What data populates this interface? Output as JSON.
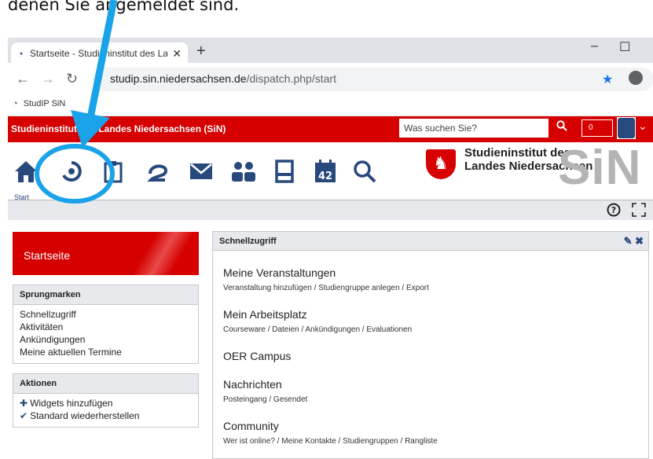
{
  "caption": "denen Sie angemeldet sind.",
  "browser": {
    "tab_title": "Startseite - Studieninstitut des La",
    "tab_close": "✕",
    "new_tab": "+",
    "minimize": "–",
    "maximize": "☐",
    "url_host": "studip.sin.niedersachsen.de",
    "url_path": "/dispatch.php/start",
    "bookmark": "StudIP SiN"
  },
  "header": {
    "site_name": "Studieninstitut des Landes Niedersachsen (SiN)",
    "search_placeholder": "Was suchen Sie?",
    "counter": "0"
  },
  "nav": {
    "start_label": "Start",
    "calendar_day": "42"
  },
  "logo": {
    "text": "Studieninstitut des\nLandes Niedersachsen",
    "sin": "SiN"
  },
  "sidebar": {
    "title": "Startseite",
    "jump_title": "Sprungmarken",
    "jump_items": [
      "Schnellzugriff",
      "Aktivitäten",
      "Ankündigungen",
      "Meine aktuellen Termine"
    ],
    "actions_title": "Aktionen",
    "action_add": "Widgets hinzufügen",
    "action_reset": "Standard wiederherstellen"
  },
  "panel": {
    "title": "Schnellzugriff",
    "sections": [
      {
        "title": "Meine Veranstaltungen",
        "links": "Veranstaltung hinzufügen / Studiengruppe anlegen / Export"
      },
      {
        "title": "Mein Arbeitsplatz",
        "links": "Courseware / Dateien / Ankündigungen / Evaluationen"
      },
      {
        "title": "OER Campus",
        "links": ""
      },
      {
        "title": "Nachrichten",
        "links": "Posteingang / Gesendet"
      },
      {
        "title": "Community",
        "links": "Wer ist online? / Meine Kontakte / Studiengruppen / Rangliste"
      }
    ]
  },
  "colors": {
    "brand_red": "#d60000",
    "accent_blue": "#28497c",
    "arrow": "#1aa3e8"
  }
}
